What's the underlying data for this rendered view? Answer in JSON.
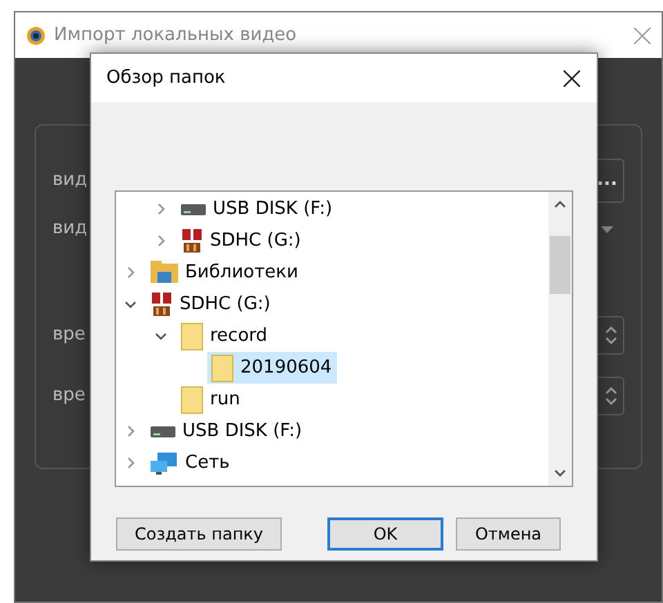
{
  "window": {
    "title": "Импорт локальных видео"
  },
  "form": {
    "rows": [
      {
        "kind": "browse",
        "label": "вид",
        "button": "..."
      },
      {
        "kind": "select",
        "label": "вид"
      },
      {
        "kind": "spin",
        "label": "вре"
      },
      {
        "kind": "spin",
        "label": "вре"
      }
    ]
  },
  "dialog": {
    "title": "Обзор папок",
    "tree": {
      "continued_items": [
        {
          "label": "USB DISK (F:)",
          "kind": "drive",
          "expandable": true,
          "expanded": false,
          "selected": false
        },
        {
          "label": "SDHC (G:)",
          "kind": "sd",
          "expandable": true,
          "expanded": false,
          "selected": false
        }
      ],
      "items": [
        {
          "label": "Библиотеки",
          "kind": "library",
          "expandable": true,
          "expanded": false,
          "selected": false
        },
        {
          "label": "SDHC (G:)",
          "kind": "sd",
          "expandable": true,
          "expanded": true,
          "selected": false,
          "children": [
            {
              "label": "record",
              "kind": "folder",
              "expandable": true,
              "expanded": true,
              "selected": false,
              "children": [
                {
                  "label": "20190604",
                  "kind": "folder",
                  "expandable": false,
                  "expanded": false,
                  "selected": true
                }
              ]
            },
            {
              "label": "run",
              "kind": "folder",
              "expandable": false,
              "expanded": false,
              "selected": false
            }
          ]
        },
        {
          "label": "USB DISK (F:)",
          "kind": "drive",
          "expandable": true,
          "expanded": false,
          "selected": false
        },
        {
          "label": "Сеть",
          "kind": "network",
          "expandable": true,
          "expanded": false,
          "selected": false
        }
      ]
    },
    "buttons": [
      {
        "label": "Создать папку",
        "default": false
      },
      {
        "label": "OK",
        "default": true
      },
      {
        "label": "Отмена",
        "default": false
      }
    ]
  }
}
